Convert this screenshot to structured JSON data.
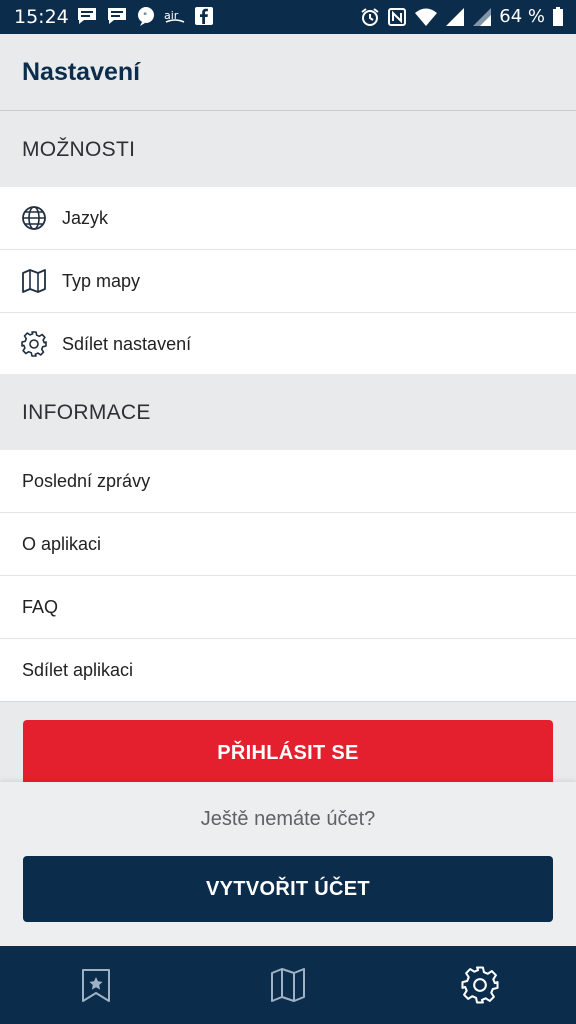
{
  "status_bar": {
    "time": "15:24",
    "battery_percent": "64 %",
    "notification_icons": [
      "message-icon",
      "message-icon",
      "chat-bubble-icon",
      "air-icon",
      "facebook-icon"
    ],
    "system_icons": [
      "alarm-icon",
      "nfc-icon",
      "wifi-icon",
      "signal-icon",
      "signal-icon",
      "battery-icon"
    ]
  },
  "header": {
    "title": "Nastavení"
  },
  "sections": {
    "options": {
      "title": "MOŽNOSTI",
      "items": [
        {
          "label": "Jazyk",
          "icon": "globe-icon"
        },
        {
          "label": "Typ mapy",
          "icon": "map-icon"
        },
        {
          "label": "Sdílet nastavení",
          "icon": "gear-icon"
        }
      ]
    },
    "info": {
      "title": "INFORMACE",
      "items": [
        {
          "label": "Poslední zprávy"
        },
        {
          "label": "O aplikaci"
        },
        {
          "label": "FAQ"
        },
        {
          "label": "Sdílet aplikaci"
        }
      ]
    }
  },
  "actions": {
    "login_label": "PŘIHLÁSIT SE",
    "no_account_text": "Ještě nemáte účet?",
    "create_account_label": "VYTVOŘIT ÚČET"
  },
  "bottom_nav": {
    "tabs": [
      {
        "icon": "bookmark-star-icon"
      },
      {
        "icon": "map-icon"
      },
      {
        "icon": "gear-icon",
        "active": true
      }
    ]
  },
  "colors": {
    "primary": "#0c2c4c",
    "accent": "#e5202e",
    "background": "#e9eaeb"
  }
}
